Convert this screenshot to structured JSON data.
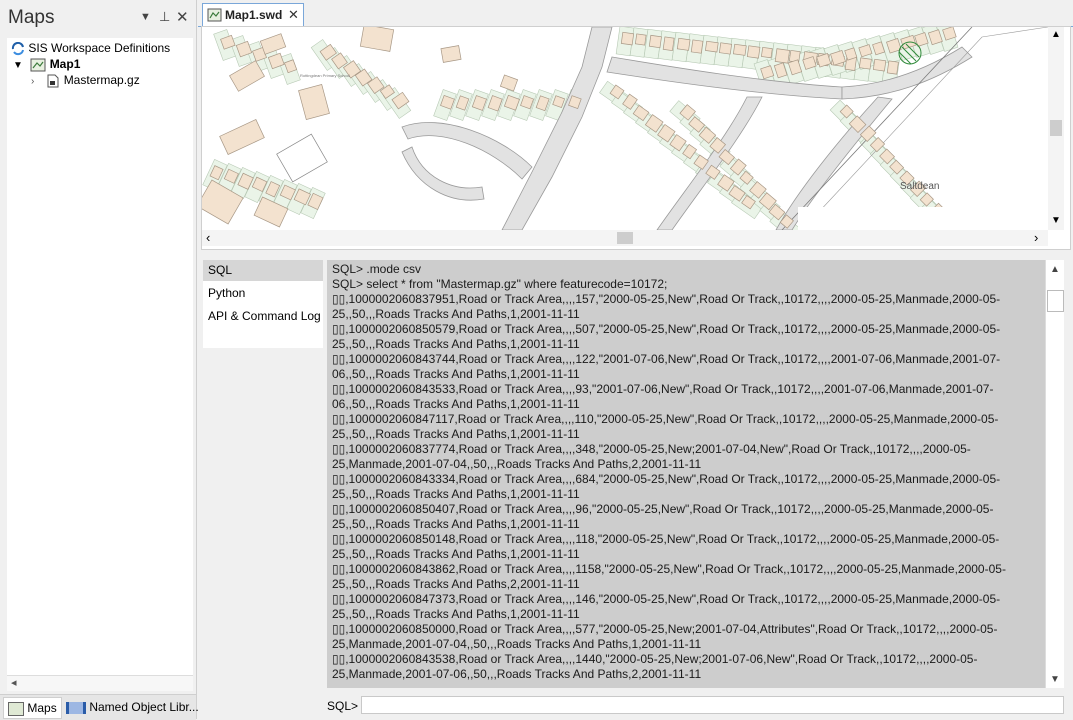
{
  "left_panel": {
    "title": "Maps",
    "tree": {
      "root": "SIS Workspace Definitions",
      "map": "Map1",
      "dataset": "Mastermap.gz"
    },
    "bottom_tabs": [
      "Maps",
      "Named Object Libr..."
    ]
  },
  "document": {
    "tab_label": "Map1.swd"
  },
  "map": {
    "place_label": "Saltdean",
    "small_label": "Rottingdean Primary School"
  },
  "console": {
    "nav_items": [
      "SQL",
      "Python",
      "API & Command Log"
    ],
    "selected_nav": "SQL",
    "lines": [
      "SQL> .mode csv",
      "SQL> select * from \"Mastermap.gz\" where featurecode=10172;",
      "▯▯,1000002060837951,Road or Track Area,,,,157,\"2000-05-25,New\",Road Or Track,,10172,,,,2000-05-25,Manmade,2000-05-",
      "25,,50,,,Roads Tracks And Paths,1,2001-11-11",
      "▯▯,1000002060850579,Road or Track Area,,,,507,\"2000-05-25,New\",Road Or Track,,10172,,,,2000-05-25,Manmade,2000-05-",
      "25,,50,,,Roads Tracks And Paths,1,2001-11-11",
      "▯▯,1000002060843744,Road or Track Area,,,,122,\"2001-07-06,New\",Road Or Track,,10172,,,,2001-07-06,Manmade,2001-07-",
      "06,,50,,,Roads Tracks And Paths,1,2001-11-11",
      "▯▯,1000002060843533,Road or Track Area,,,,93,\"2001-07-06,New\",Road Or Track,,10172,,,,2001-07-06,Manmade,2001-07-",
      "06,,50,,,Roads Tracks And Paths,1,2001-11-11",
      "▯▯,1000002060847117,Road or Track Area,,,,110,\"2000-05-25,New\",Road Or Track,,10172,,,,2000-05-25,Manmade,2000-05-",
      "25,,50,,,Roads Tracks And Paths,1,2001-11-11",
      "▯▯,1000002060837774,Road or Track Area,,,,348,\"2000-05-25,New;2001-07-04,New\",Road Or Track,,10172,,,,2000-05-",
      "25,Manmade,2001-07-04,,50,,,Roads Tracks And Paths,2,2001-11-11",
      "▯▯,1000002060843334,Road or Track Area,,,,684,\"2000-05-25,New\",Road Or Track,,10172,,,,2000-05-25,Manmade,2000-05-",
      "25,,50,,,Roads Tracks And Paths,1,2001-11-11",
      "▯▯,1000002060850407,Road or Track Area,,,,96,\"2000-05-25,New\",Road Or Track,,10172,,,,2000-05-25,Manmade,2000-05-",
      "25,,50,,,Roads Tracks And Paths,1,2001-11-11",
      "▯▯,1000002060850148,Road or Track Area,,,,118,\"2000-05-25,New\",Road Or Track,,10172,,,,2000-05-25,Manmade,2000-05-",
      "25,,50,,,Roads Tracks And Paths,1,2001-11-11",
      "▯▯,1000002060843862,Road or Track Area,,,,1158,\"2000-05-25,New\",Road Or Track,,10172,,,,2000-05-25,Manmade,2000-05-",
      "25,,50,,,Roads Tracks And Paths,2,2001-11-11",
      "▯▯,1000002060847373,Road or Track Area,,,,146,\"2000-05-25,New\",Road Or Track,,10172,,,,2000-05-25,Manmade,2000-05-",
      "25,,50,,,Roads Tracks And Paths,1,2001-11-11",
      "▯▯,1000002060850000,Road or Track Area,,,,577,\"2000-05-25,New;2001-07-04,Attributes\",Road Or Track,,10172,,,,2000-05-",
      "25,Manmade,2001-07-04,,50,,,Roads Tracks And Paths,1,2001-11-11",
      "▯▯,1000002060843538,Road or Track Area,,,,1440,\"2000-05-25,New;2001-07-06,New\",Road Or Track,,10172,,,,2000-05-",
      "25,Manmade,2001-07-06,,50,,,Roads Tracks And Paths,2,2001-11-11"
    ],
    "prompt_label": "SQL>",
    "input_value": ""
  },
  "colors": {
    "building_fill": "#f3e2cf",
    "building_stroke": "#a89886",
    "parcel_fill": "#eaf4e8",
    "road_fill": "#e2e2e2",
    "console_bg": "#cdcdcd",
    "selected_nav": "#d6d6d6"
  }
}
